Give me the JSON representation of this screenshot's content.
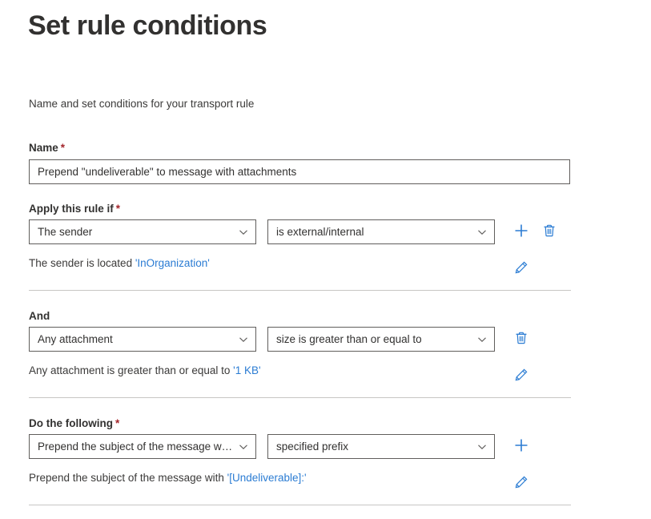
{
  "header": {
    "title": "Set rule conditions",
    "subtitle": "Name and set conditions for your transport rule"
  },
  "accent_color": "#2b7cd3",
  "required_marker_color": "#a4262c",
  "required_marker": "*",
  "name_field": {
    "label": "Name",
    "required": true,
    "value": "Prepend \"undeliverable\" to message with attachments",
    "placeholder": "Enter a name"
  },
  "sections": [
    {
      "id": "condition-1",
      "label": "Apply this rule if",
      "required": true,
      "predicate_dropdown": {
        "value": "The sender",
        "icon": "chevron-down-icon"
      },
      "operator_dropdown": {
        "value": "is external/internal",
        "icon": "chevron-down-icon"
      },
      "actions": [
        {
          "icon": "plus-icon",
          "name": "add-condition-button"
        },
        {
          "icon": "trash-icon",
          "name": "delete-condition-button"
        }
      ],
      "description": {
        "prefix": "The sender is located ",
        "highlight": "'InOrganization'"
      },
      "edit_icon": "pencil-icon"
    },
    {
      "id": "condition-2",
      "label": "And",
      "required": false,
      "predicate_dropdown": {
        "value": "Any attachment",
        "icon": "chevron-down-icon"
      },
      "operator_dropdown": {
        "value": "size is greater than or equal to",
        "icon": "chevron-down-icon"
      },
      "actions": [
        {
          "icon": "trash-icon",
          "name": "delete-condition-button"
        }
      ],
      "description": {
        "prefix": "Any attachment is greater than or equal to ",
        "highlight": "'1 KB'"
      },
      "edit_icon": "pencil-icon"
    },
    {
      "id": "action-1",
      "label": "Do the following",
      "required": true,
      "predicate_dropdown": {
        "value": "Prepend the subject of the message w…",
        "icon": "chevron-down-icon"
      },
      "operator_dropdown": {
        "value": "specified prefix",
        "icon": "chevron-down-icon"
      },
      "actions": [
        {
          "icon": "plus-icon",
          "name": "add-action-button"
        }
      ],
      "description": {
        "prefix": "Prepend the subject of the message with ",
        "highlight": "'[Undeliverable]:'"
      },
      "edit_icon": "pencil-icon"
    }
  ]
}
